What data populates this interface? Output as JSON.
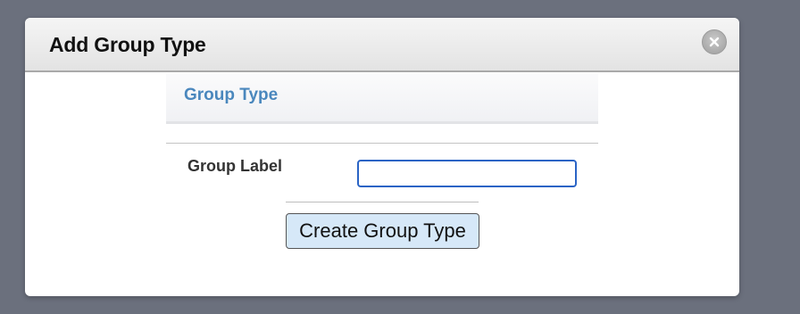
{
  "dialog": {
    "title": "Add Group Type",
    "close_icon": "close-icon"
  },
  "section": {
    "title": "Group Type"
  },
  "form": {
    "group_label": {
      "label": "Group Label",
      "value": "",
      "placeholder": ""
    },
    "submit_label": "Create Group Type"
  },
  "colors": {
    "backdrop": "#6b707d",
    "section_title": "#4a87bd",
    "input_focus_border": "#2a64c5",
    "button_bg": "#d6e8f8"
  }
}
